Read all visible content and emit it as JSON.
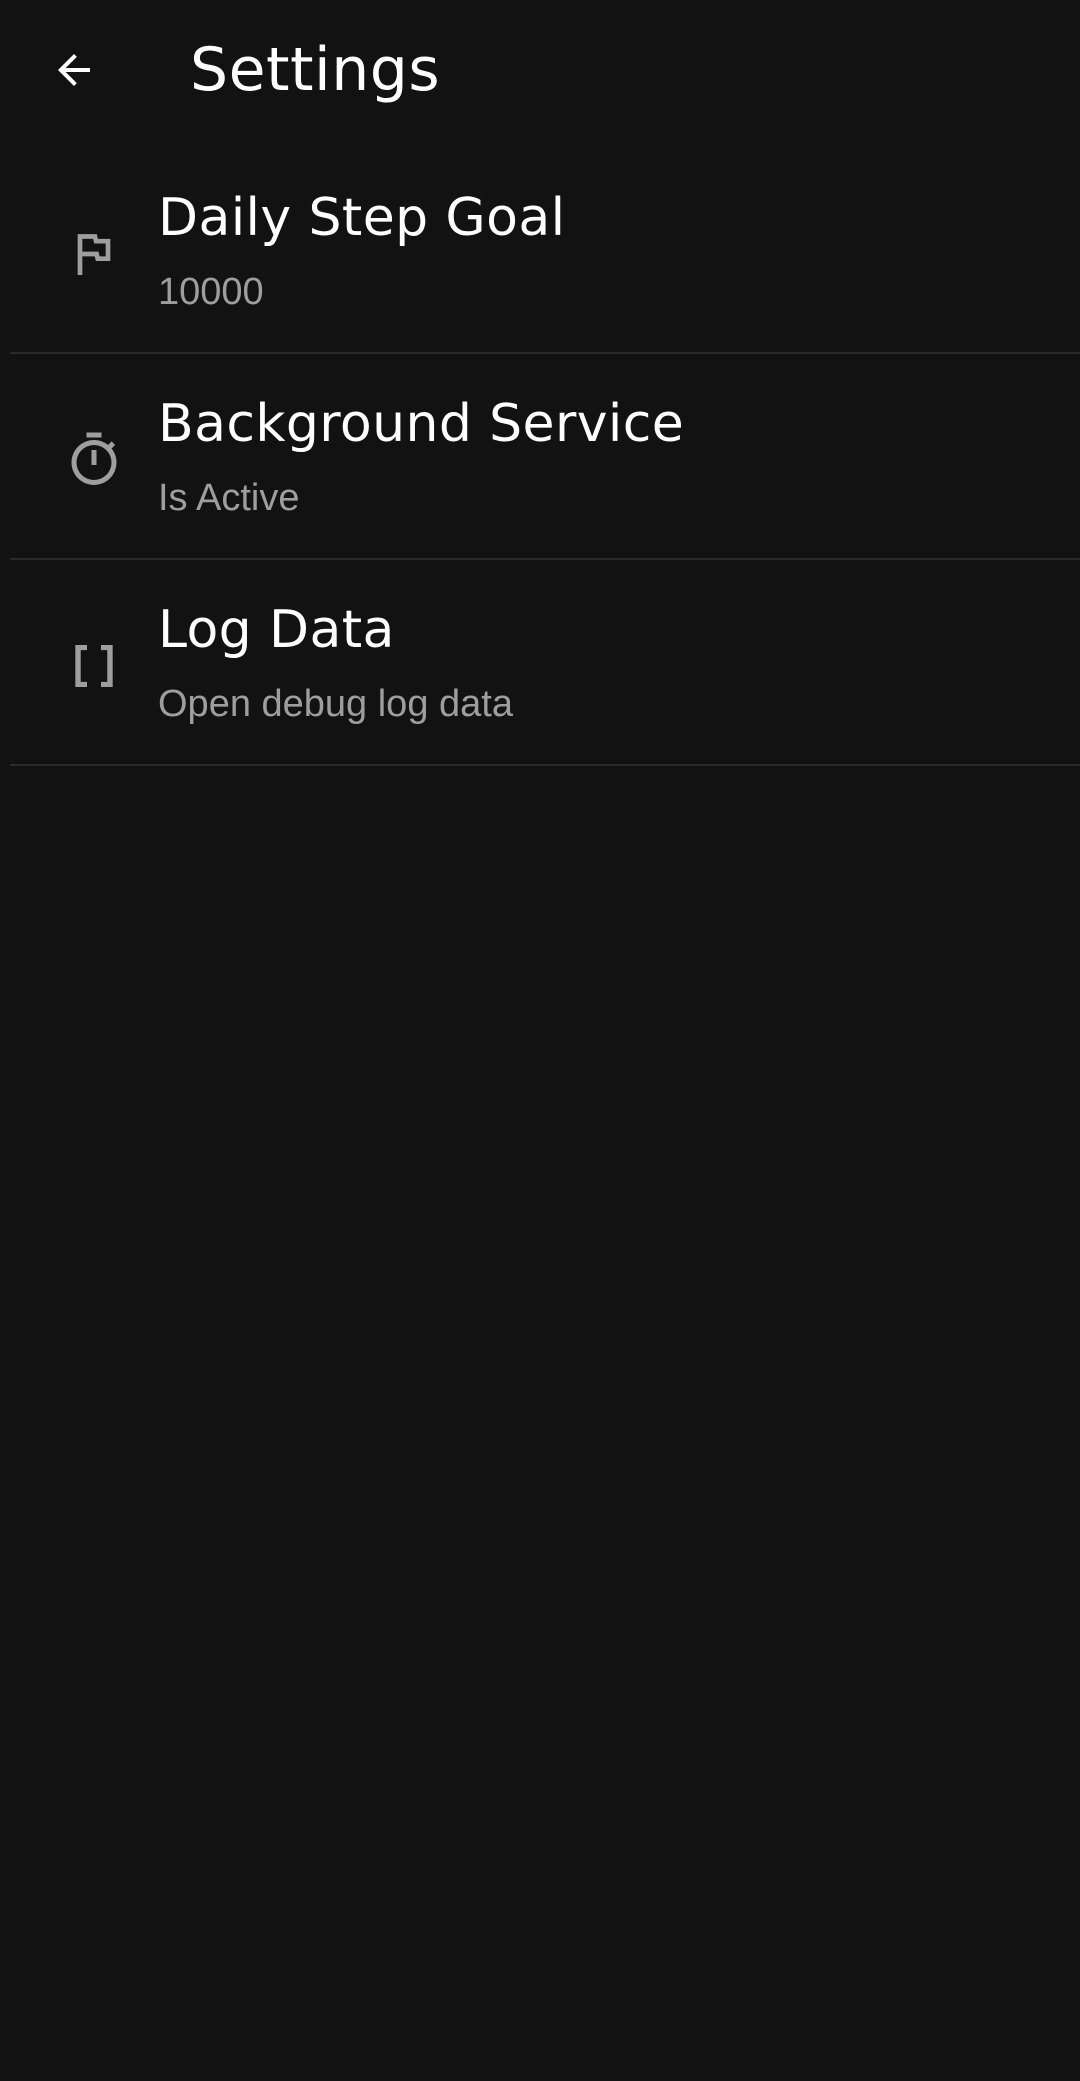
{
  "app_bar": {
    "back_icon": "arrow-back-icon",
    "title": "Settings"
  },
  "settings": [
    {
      "icon": "flag-icon",
      "title": "Daily Step Goal",
      "subtitle": "10000"
    },
    {
      "icon": "timer-icon",
      "title": "Background Service",
      "subtitle": "Is Active"
    },
    {
      "icon": "brackets-icon",
      "title": "Log Data",
      "subtitle": "Open debug log data"
    }
  ],
  "colors": {
    "background": "#121212",
    "text_primary": "#ffffff",
    "text_secondary": "#9e9e9e",
    "icon": "#9e9e9e",
    "divider": "#2a2a2a"
  }
}
